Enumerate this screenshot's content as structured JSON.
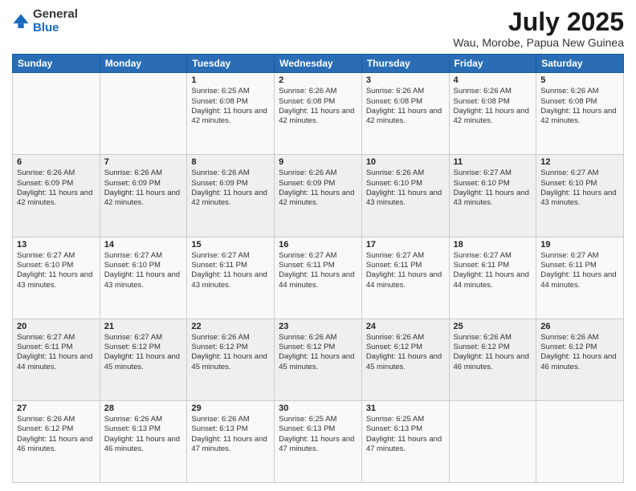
{
  "header": {
    "logo": {
      "general": "General",
      "blue": "Blue"
    },
    "month": "July 2025",
    "location": "Wau, Morobe, Papua New Guinea"
  },
  "weekdays": [
    "Sunday",
    "Monday",
    "Tuesday",
    "Wednesday",
    "Thursday",
    "Friday",
    "Saturday"
  ],
  "weeks": [
    [
      {
        "day": "",
        "info": ""
      },
      {
        "day": "",
        "info": ""
      },
      {
        "day": "1",
        "info": "Sunrise: 6:25 AM\nSunset: 6:08 PM\nDaylight: 11 hours and 42 minutes."
      },
      {
        "day": "2",
        "info": "Sunrise: 6:26 AM\nSunset: 6:08 PM\nDaylight: 11 hours and 42 minutes."
      },
      {
        "day": "3",
        "info": "Sunrise: 6:26 AM\nSunset: 6:08 PM\nDaylight: 11 hours and 42 minutes."
      },
      {
        "day": "4",
        "info": "Sunrise: 6:26 AM\nSunset: 6:08 PM\nDaylight: 11 hours and 42 minutes."
      },
      {
        "day": "5",
        "info": "Sunrise: 6:26 AM\nSunset: 6:08 PM\nDaylight: 11 hours and 42 minutes."
      }
    ],
    [
      {
        "day": "6",
        "info": "Sunrise: 6:26 AM\nSunset: 6:09 PM\nDaylight: 11 hours and 42 minutes."
      },
      {
        "day": "7",
        "info": "Sunrise: 6:26 AM\nSunset: 6:09 PM\nDaylight: 11 hours and 42 minutes."
      },
      {
        "day": "8",
        "info": "Sunrise: 6:26 AM\nSunset: 6:09 PM\nDaylight: 11 hours and 42 minutes."
      },
      {
        "day": "9",
        "info": "Sunrise: 6:26 AM\nSunset: 6:09 PM\nDaylight: 11 hours and 42 minutes."
      },
      {
        "day": "10",
        "info": "Sunrise: 6:26 AM\nSunset: 6:10 PM\nDaylight: 11 hours and 43 minutes."
      },
      {
        "day": "11",
        "info": "Sunrise: 6:27 AM\nSunset: 6:10 PM\nDaylight: 11 hours and 43 minutes."
      },
      {
        "day": "12",
        "info": "Sunrise: 6:27 AM\nSunset: 6:10 PM\nDaylight: 11 hours and 43 minutes."
      }
    ],
    [
      {
        "day": "13",
        "info": "Sunrise: 6:27 AM\nSunset: 6:10 PM\nDaylight: 11 hours and 43 minutes."
      },
      {
        "day": "14",
        "info": "Sunrise: 6:27 AM\nSunset: 6:10 PM\nDaylight: 11 hours and 43 minutes."
      },
      {
        "day": "15",
        "info": "Sunrise: 6:27 AM\nSunset: 6:11 PM\nDaylight: 11 hours and 43 minutes."
      },
      {
        "day": "16",
        "info": "Sunrise: 6:27 AM\nSunset: 6:11 PM\nDaylight: 11 hours and 44 minutes."
      },
      {
        "day": "17",
        "info": "Sunrise: 6:27 AM\nSunset: 6:11 PM\nDaylight: 11 hours and 44 minutes."
      },
      {
        "day": "18",
        "info": "Sunrise: 6:27 AM\nSunset: 6:11 PM\nDaylight: 11 hours and 44 minutes."
      },
      {
        "day": "19",
        "info": "Sunrise: 6:27 AM\nSunset: 6:11 PM\nDaylight: 11 hours and 44 minutes."
      }
    ],
    [
      {
        "day": "20",
        "info": "Sunrise: 6:27 AM\nSunset: 6:11 PM\nDaylight: 11 hours and 44 minutes."
      },
      {
        "day": "21",
        "info": "Sunrise: 6:27 AM\nSunset: 6:12 PM\nDaylight: 11 hours and 45 minutes."
      },
      {
        "day": "22",
        "info": "Sunrise: 6:26 AM\nSunset: 6:12 PM\nDaylight: 11 hours and 45 minutes."
      },
      {
        "day": "23",
        "info": "Sunrise: 6:26 AM\nSunset: 6:12 PM\nDaylight: 11 hours and 45 minutes."
      },
      {
        "day": "24",
        "info": "Sunrise: 6:26 AM\nSunset: 6:12 PM\nDaylight: 11 hours and 45 minutes."
      },
      {
        "day": "25",
        "info": "Sunrise: 6:26 AM\nSunset: 6:12 PM\nDaylight: 11 hours and 46 minutes."
      },
      {
        "day": "26",
        "info": "Sunrise: 6:26 AM\nSunset: 6:12 PM\nDaylight: 11 hours and 46 minutes."
      }
    ],
    [
      {
        "day": "27",
        "info": "Sunrise: 6:26 AM\nSunset: 6:12 PM\nDaylight: 11 hours and 46 minutes."
      },
      {
        "day": "28",
        "info": "Sunrise: 6:26 AM\nSunset: 6:13 PM\nDaylight: 11 hours and 46 minutes."
      },
      {
        "day": "29",
        "info": "Sunrise: 6:26 AM\nSunset: 6:13 PM\nDaylight: 11 hours and 47 minutes."
      },
      {
        "day": "30",
        "info": "Sunrise: 6:25 AM\nSunset: 6:13 PM\nDaylight: 11 hours and 47 minutes."
      },
      {
        "day": "31",
        "info": "Sunrise: 6:25 AM\nSunset: 6:13 PM\nDaylight: 11 hours and 47 minutes."
      },
      {
        "day": "",
        "info": ""
      },
      {
        "day": "",
        "info": ""
      }
    ]
  ]
}
